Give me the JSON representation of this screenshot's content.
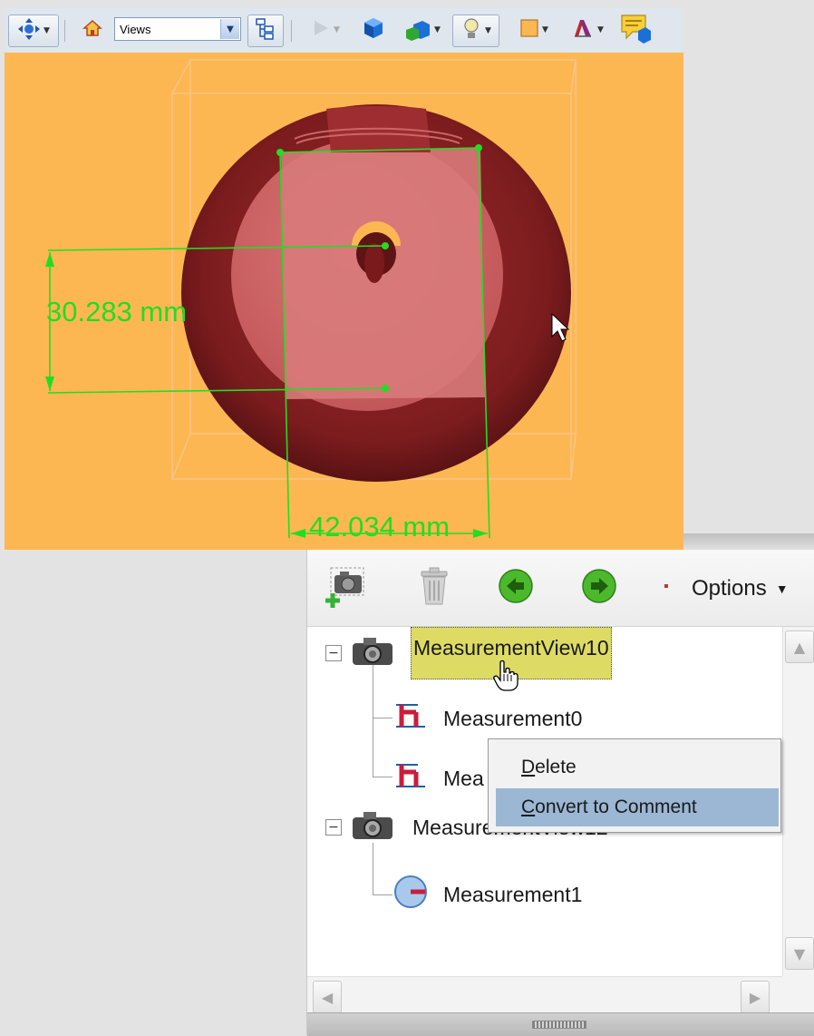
{
  "toolbar": {
    "views_select_value": "Views",
    "icons": [
      "move-icon",
      "home-icon",
      "model-tree-icon",
      "play-icon",
      "cube-icon",
      "views-cube-icon",
      "light-icon",
      "color-swatch-icon",
      "material-icon",
      "comment-icon"
    ],
    "background_color": "#fdb752"
  },
  "viewport": {
    "dimension_vertical": "30.283 mm",
    "dimension_horizontal": "42.034 mm",
    "model_color": "#7c1c1e",
    "measurement_color": "#22dd22"
  },
  "panel": {
    "toolbar": {
      "icons": [
        "add-camera-view-icon",
        "trash-icon",
        "previous-arrow-icon",
        "next-arrow-icon"
      ],
      "options_label": "Options"
    },
    "tree": [
      {
        "label": "MeasurementView10",
        "type": "camera-view",
        "selected": true
      },
      {
        "label": "Measurement0",
        "type": "linear-measurement"
      },
      {
        "label": "Mea",
        "type": "linear-measurement"
      },
      {
        "label": "MeasurementView12",
        "type": "camera-view"
      },
      {
        "label": "Measurement1",
        "type": "radial-measurement"
      }
    ]
  },
  "context_menu": {
    "items": [
      {
        "label": "Delete",
        "underline": "D",
        "rest": "elete",
        "highlighted": false
      },
      {
        "label": "Convert to Comment",
        "underline": "C",
        "rest": "onvert to Comment",
        "highlighted": true
      }
    ]
  }
}
